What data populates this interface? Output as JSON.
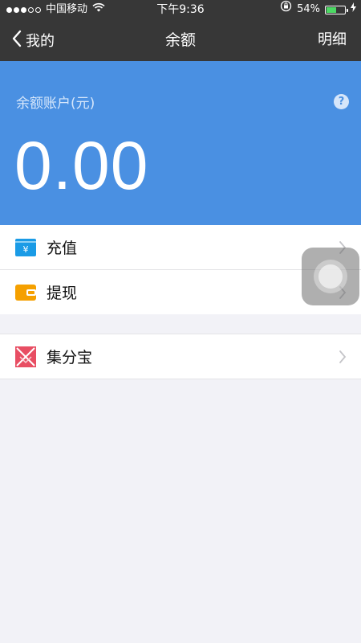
{
  "status_bar": {
    "carrier": "中国移动",
    "time": "下午9:36",
    "battery_percent": "54%",
    "battery_level": 0.54
  },
  "nav": {
    "back_label": "我的",
    "title": "余额",
    "detail_label": "明细"
  },
  "balance": {
    "label": "余额账户(元)",
    "help": "?",
    "amount": "0.00"
  },
  "menu": {
    "recharge": "充值",
    "withdraw": "提现",
    "jifenbao": "集分宝"
  },
  "colors": {
    "header": "#373737",
    "balance_bg": "#4a90e2",
    "recharge_icon": "#1a9be6",
    "withdraw_icon": "#f5a000",
    "jifenbao_icon": "#e84e63"
  }
}
